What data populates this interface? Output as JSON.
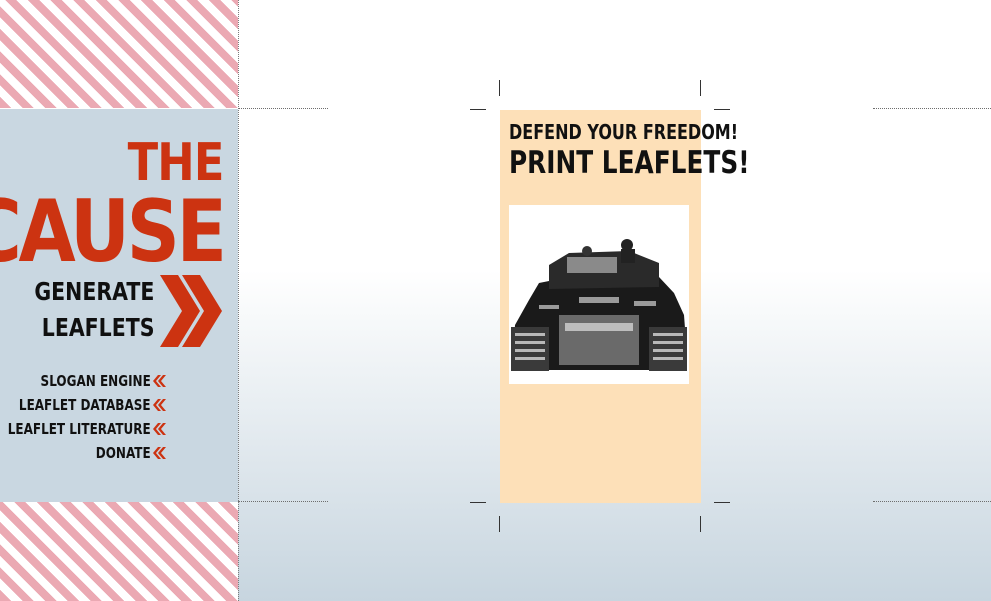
{
  "sidebar": {
    "logo": {
      "line1": "THE",
      "line2": "CAUSE"
    },
    "cta": {
      "line1": "GENERATE",
      "line2": "LEAFLETS"
    },
    "nav": [
      {
        "label": "SLOGAN ENGINE"
      },
      {
        "label": "LEAFLET DATABASE"
      },
      {
        "label": "LEAFLET LITERATURE"
      },
      {
        "label": "DONATE"
      }
    ]
  },
  "leaflet": {
    "headline_small": "DEFEND YOUR FREEDOM!",
    "headline_large": "PRINT LEAFLETS!",
    "image": "tank-photo"
  },
  "colors": {
    "accent": "#cc3311",
    "sidebar_bg": "#c9d7e1",
    "leaflet_bg": "#fde0b8",
    "stripe": "#eba9b3"
  }
}
